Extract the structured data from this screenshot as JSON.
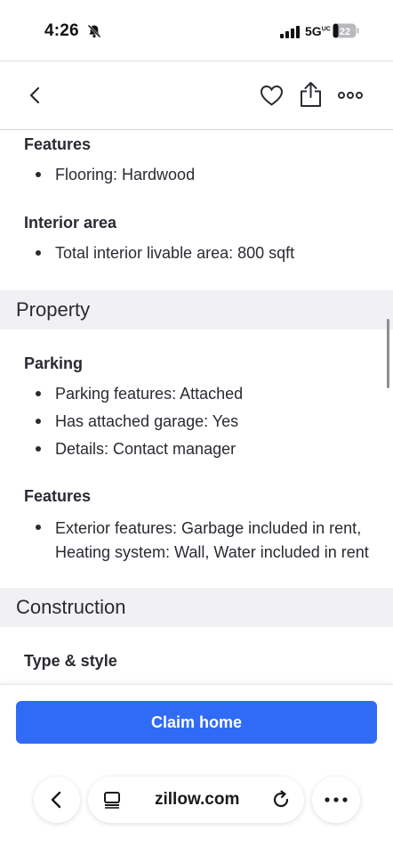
{
  "status_bar": {
    "time": "4:26",
    "network": "5G",
    "network_superscript": "UC",
    "battery": "22"
  },
  "nav": {
    "back_icon": "chevron-left-icon",
    "favorite_icon": "heart-icon",
    "share_icon": "share-icon",
    "more_icon": "more-icon"
  },
  "content": {
    "interior_features": {
      "title": "Features",
      "items": [
        "Flooring: Hardwood"
      ]
    },
    "interior_area": {
      "title": "Interior area",
      "items": [
        "Total interior livable area: 800 sqft"
      ]
    },
    "property_section": {
      "title": "Property",
      "parking": {
        "title": "Parking",
        "items": [
          "Parking features: Attached",
          "Has attached garage: Yes",
          "Details: Contact manager"
        ]
      },
      "features": {
        "title": "Features",
        "items": [
          "Exterior features: Garbage included in rent, Heating system: Wall, Water included in rent"
        ]
      }
    },
    "construction_section": {
      "title": "Construction",
      "type_style": {
        "title": "Type & style"
      }
    }
  },
  "actions": {
    "claim_label": "Claim home"
  },
  "browser": {
    "url": "zillow.com"
  },
  "colors": {
    "accent": "#2f6bf5",
    "section_band": "#f1f1f4",
    "text": "#2a2a33"
  }
}
